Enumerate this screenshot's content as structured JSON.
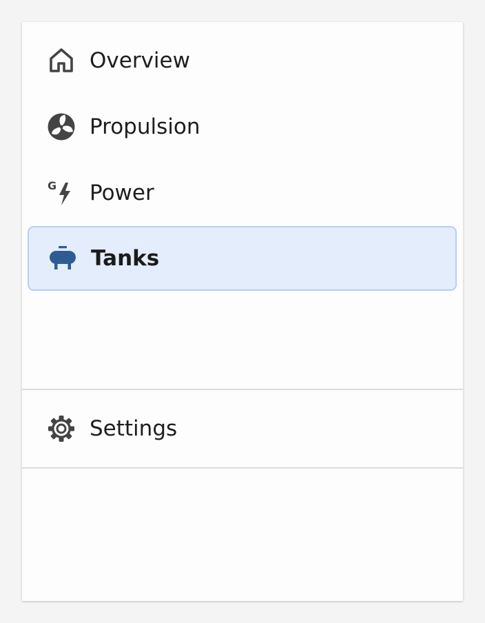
{
  "nav": {
    "items": [
      {
        "label": "Overview",
        "icon": "home-icon"
      },
      {
        "label": "Propulsion",
        "icon": "fan-icon"
      },
      {
        "label": "Power",
        "icon": "generator-bolt-icon"
      },
      {
        "label": "Tanks",
        "icon": "tank-icon",
        "active": true
      }
    ]
  },
  "footer": {
    "settings_label": "Settings",
    "settings_icon": "gear-icon"
  },
  "colors": {
    "page_background": "#f4f4f4",
    "panel_background": "#fdfdfd",
    "active_background": "#e3edfb",
    "active_border": "#b4d0f2",
    "active_icon": "#2e5c92",
    "icon": "#444444",
    "text": "#1e1e1e",
    "divider": "#dcdcdc"
  }
}
